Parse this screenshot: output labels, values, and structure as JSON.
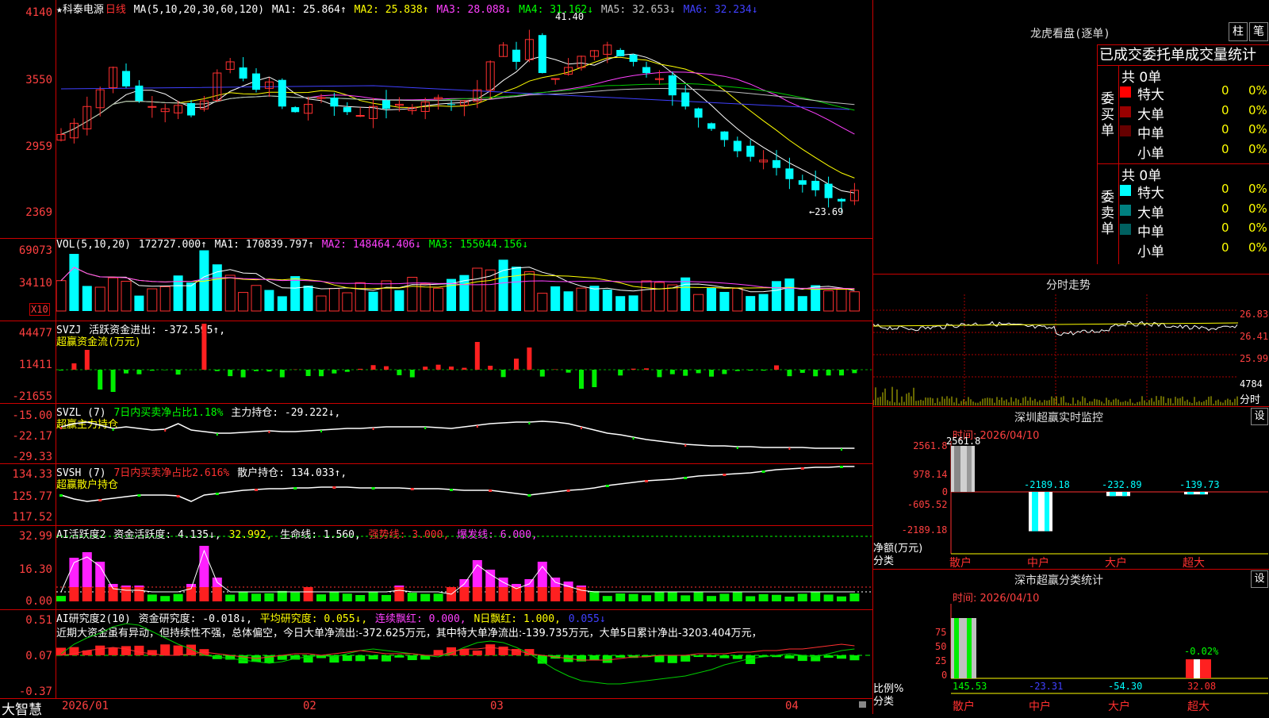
{
  "logo": "大智慧",
  "kline": {
    "title": "★科泰电源",
    "period": "日线",
    "ma_label": "MA(5,10,20,30,60,120)",
    "ma1": "MA1: 25.864↑",
    "ma2": "MA2: 25.838↑",
    "ma3": "MA3: 28.088↓",
    "ma4": "MA4: 31.162↓",
    "ma5": "MA5: 32.653↓",
    "ma6": "MA6: 32.234↓",
    "yticks": [
      "4140",
      "3550",
      "2959",
      "2369"
    ],
    "high_label": "41.40",
    "low_label": "←23.69"
  },
  "vol": {
    "label": "VOL(5,10,20)",
    "v": "172727.000↑",
    "ma1": "MA1: 170839.797↑",
    "ma2": "MA2: 148464.406↓",
    "ma3": "MA3: 155044.156↓",
    "yticks": [
      "69073",
      "34110"
    ],
    "unit": "X10"
  },
  "svzj": {
    "label": "SVZJ",
    "text": "活跃资金进出: -372.595↑,",
    "sub": "超赢资金流(万元)",
    "yticks": [
      "44477",
      "11411",
      "-21655"
    ]
  },
  "svzl": {
    "label": "SVZL (7)",
    "text1": "7日内买卖净占比1.18%",
    "text2": "主力持仓: -29.222↓,",
    "sub": "超赢主力持仓",
    "yticks": [
      "-15.00",
      "-22.17",
      "-29.33"
    ]
  },
  "svsh": {
    "label": "SVSH (7)",
    "text1": "7日内买卖净占比2.616%",
    "text2": "散户持仓: 134.033↑,",
    "sub": "超赢散户持仓",
    "yticks": [
      "134.33",
      "125.77",
      "117.52"
    ]
  },
  "ai1": {
    "label": "AI活跃度2",
    "t1": "资金活跃度: 4.135↓,",
    "t2": "32.992,",
    "t3": "生命线: 1.560,",
    "t4": "强势线: 3.000,",
    "t5": "爆发线: 6.000,",
    "yticks": [
      "32.99",
      "16.30",
      "0.00"
    ]
  },
  "ai2": {
    "label": "AI研究度2(10)",
    "t1": "资金研究度: -0.018↓,",
    "t2": "平均研究度: 0.055↓,",
    "t3": "连续飘红: 0.000,",
    "t4": "N日飘红: 1.000,",
    "t5": "0.055↓",
    "comment": "近期大资金虽有异动，但持续性不强，总体偏空，今日大单净流出:-372.625万元，其中特大单净流出:-139.735万元，大单5日累计净出-3203.404万元，",
    "yticks": [
      "0.51",
      "0.07",
      "-0.37"
    ]
  },
  "xaxis": [
    "2026/01",
    "02",
    "03",
    "04"
  ],
  "longhu": {
    "title": "龙虎看盘(逐单)",
    "btn1": "柱",
    "btn2": "笔",
    "header": "已成交委托单成交量统计",
    "buy_label": "委买单",
    "sell_label": "委卖单",
    "buy_total": "共 0单",
    "sell_total": "共 0单",
    "buy_rows": [
      {
        "name": "特大",
        "n": "0",
        "pct": "0%",
        "color": "#ff0000"
      },
      {
        "name": "大单",
        "n": "0",
        "pct": "0%",
        "color": "#990000"
      },
      {
        "name": "中单",
        "n": "0",
        "pct": "0%",
        "color": "#660000"
      },
      {
        "name": "小单",
        "n": "0",
        "pct": "0%",
        "color": "#000000"
      }
    ],
    "sell_rows": [
      {
        "name": "特大",
        "n": "0",
        "pct": "0%",
        "color": "#00ffff"
      },
      {
        "name": "大单",
        "n": "0",
        "pct": "0%",
        "color": "#008080"
      },
      {
        "name": "中单",
        "n": "0",
        "pct": "0%",
        "color": "#006060"
      },
      {
        "name": "小单",
        "n": "0",
        "pct": "0%",
        "color": "#000000"
      }
    ]
  },
  "fenshi": {
    "title": "分时走势",
    "yticks": [
      "26.83",
      "26.41",
      "25.99"
    ],
    "vol": "4784",
    "vol_label": "分时"
  },
  "monitor": {
    "title": "深圳超赢实时监控",
    "btn": "设",
    "time": "时间: 2026/04/10",
    "yticks": [
      "2561.8",
      "978.14",
      "0",
      "-605.52",
      "-2189.18"
    ],
    "ylabel": "净额(万元)",
    "xlabel": "分类",
    "values": [
      "2561.8",
      "-2189.18",
      "-232.89",
      "-139.73"
    ],
    "cats": [
      "散户",
      "中户",
      "大户",
      "超大"
    ]
  },
  "classify": {
    "title": "深市超赢分类统计",
    "btn": "设",
    "time": "时间: 2026/04/10",
    "yticks": [
      "75",
      "50",
      "25",
      "0"
    ],
    "ylabel": "比例%",
    "xlabel": "分类",
    "values": [
      "145.53",
      "-23.31",
      "-54.30",
      "32.08"
    ],
    "top_label": "-0.02%",
    "cats": [
      "散户",
      "中户",
      "大户",
      "超大"
    ]
  }
}
